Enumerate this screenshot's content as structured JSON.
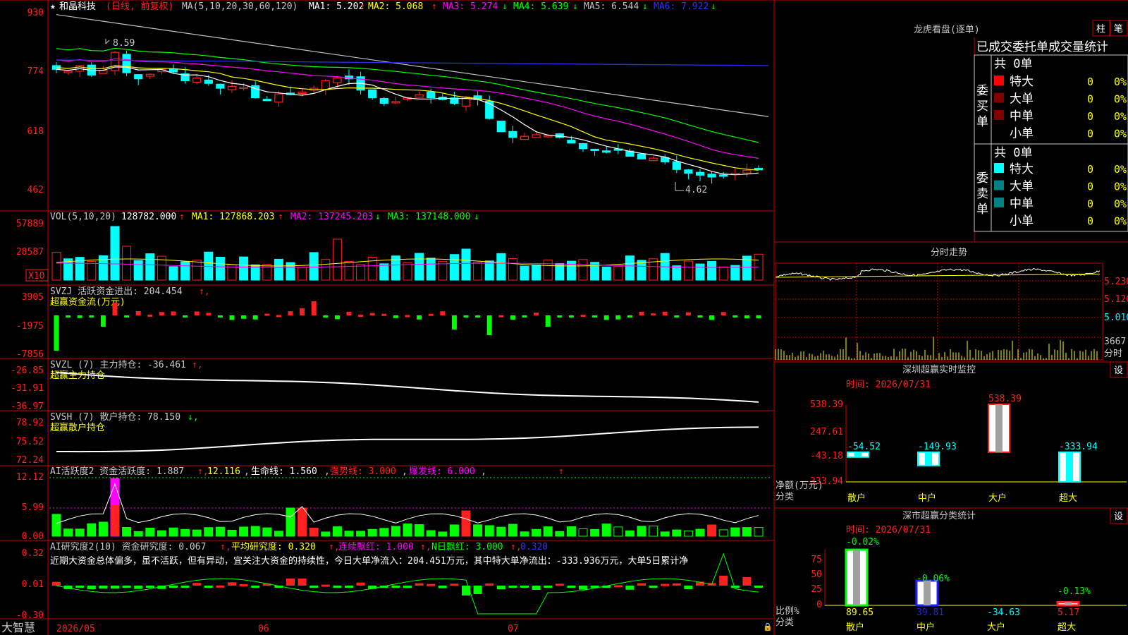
{
  "colors": {
    "up": "#ff2020",
    "down": "#00ffff",
    "ma1": "#ffffff",
    "ma2": "#ffff00",
    "ma3": "#ff00ff",
    "ma4": "#00ff00",
    "ma5": "#c0c0c0",
    "ma6": "#3030ff",
    "grid": "#c00000",
    "green": "#00ff00",
    "yellow": "#ffff00",
    "magenta": "#ff00ff",
    "blue": "#2020ff",
    "gray": "#b0b0b0",
    "teal": "#008080",
    "darkred": "#800000"
  },
  "stock_name": "和晶科技",
  "period_label": "(日线, 前复权)",
  "ma_header": {
    "formula": "MA(5,10,20,30,60,120)",
    "items": [
      {
        "label": "MA1: 5.202",
        "dir": "↑"
      },
      {
        "label": "MA2: 5.068",
        "dir": "↑"
      },
      {
        "label": "MA3: 5.274",
        "dir": "↓"
      },
      {
        "label": "MA4: 5.639",
        "dir": "↓"
      },
      {
        "label": "MA5: 6.544",
        "dir": "↓"
      },
      {
        "label": "MA6: 7.922",
        "dir": "↓"
      }
    ]
  },
  "price_axis": [
    "930",
    "774",
    "618",
    "462"
  ],
  "price_high_label": "8.59",
  "price_low_label": "4.62",
  "vol_header": {
    "formula": "VOL(5,10,20)",
    "value": "128782.000",
    "ma1": "MA1: 127868.203",
    "ma2": "MA2: 137245.203",
    "ma3": "MA3: 137148.000"
  },
  "vol_axis": [
    "57889",
    "28587"
  ],
  "vol_unit": "X10",
  "svzj": {
    "title": "SVZJ  活跃资金进出: 204.454",
    "subtitle": "超赢资金流(万元)",
    "axis": [
      "3905",
      "-1975",
      "-7856"
    ]
  },
  "svzl": {
    "title": "SVZL (7) 主力持仓: -36.461",
    "subtitle": "超赢主力持仓",
    "axis": [
      "-26.85",
      "-31.91",
      "-36.97"
    ]
  },
  "svsh": {
    "title": "SVSH (7) 散户持仓: 78.150",
    "subtitle": "超赢散户持仓",
    "axis": [
      "78.92",
      "75.52",
      "72.24"
    ]
  },
  "ai_act": {
    "title": "AI活跃度2 资金活跃度: 1.887",
    "v2": "12.116",
    "v3": "生命线: 1.560",
    "v4": "强势线: 3.000",
    "v5": "爆发线: 6.000",
    "axis": [
      "12.12",
      "5.99",
      "0.00"
    ]
  },
  "ai_res": {
    "title": "AI研究度2(10) 资金研究度: 0.067",
    "v2": "平均研究度: 0.320",
    "v3": "连续飘红: 1.000",
    "v4": "N日飘红: 3.000",
    "v5": "0.320",
    "summary": "近期大资金总体偏多，虽不活跃，但有异动，宜关注大资金的持续性，今日大单净流入：204.451万元，其中特大单净流出：-333.936万元，大单5日累计净",
    "axis": [
      "0.32",
      "0.01",
      "-0.30"
    ]
  },
  "date_axis": [
    "2026/05",
    "06",
    "07"
  ],
  "brand": "大智慧",
  "right": {
    "lhkp_title": "龙虎看盘(逐单)",
    "btn_zhu": "柱",
    "btn_bi": "笔",
    "table_title": "已成交委托单成交量统计",
    "buy_label": "委买单",
    "sell_label": "委卖单",
    "buy_total": "共 0单",
    "sell_total": "共 0单",
    "buy_rows": [
      {
        "name": "特大",
        "count": "0",
        "pct": "0%",
        "color": "#ff0000"
      },
      {
        "name": "大单",
        "count": "0",
        "pct": "0%",
        "color": "#800000"
      },
      {
        "name": "中单",
        "count": "0",
        "pct": "0%",
        "color": "#800000"
      },
      {
        "name": "小单",
        "count": "0",
        "pct": "0%",
        "color": ""
      }
    ],
    "sell_rows": [
      {
        "name": "特大",
        "count": "0",
        "pct": "0%",
        "color": "#00ffff"
      },
      {
        "name": "大单",
        "count": "0",
        "pct": "0%",
        "color": "#008080"
      },
      {
        "name": "中单",
        "count": "0",
        "pct": "0%",
        "color": "#008080"
      },
      {
        "name": "小单",
        "count": "0",
        "pct": "0%",
        "color": ""
      }
    ],
    "fs_title": "分时走势",
    "fs_axis": [
      "5.230",
      "5.120",
      "5.010"
    ],
    "fs_vol": "3667",
    "fs_vol_label": "分时",
    "sz_title": "深圳超赢实时监控",
    "btn_set": "设",
    "sz_time": "时间: 2026/07/31",
    "sz_axis": [
      "538.39",
      "247.61",
      "-43.18",
      "-333.94"
    ],
    "sz_ylabel": "净额(万元)",
    "sz_xlabel": "分类",
    "sz_bars": [
      {
        "name": "散户",
        "value": -54.52,
        "label": "-54.52"
      },
      {
        "name": "中户",
        "value": -149.93,
        "label": "-149.93"
      },
      {
        "name": "大户",
        "value": 538.39,
        "label": "538.39"
      },
      {
        "name": "超大",
        "value": -333.94,
        "label": "-333.94"
      }
    ],
    "cls_title": "深市超赢分类统计",
    "cls_time": "时间: 2026/07/31",
    "cls_axis": [
      "75",
      "50",
      "25",
      "0"
    ],
    "cls_ylabel": "比例%",
    "cls_xlabel": "分类",
    "cls_bars": [
      {
        "name": "散户",
        "value": 89.65,
        "label": "89.65",
        "chg": "-0.02%"
      },
      {
        "name": "中户",
        "value": 39.81,
        "label": "39.81",
        "chg": "-0.06%"
      },
      {
        "name": "大户",
        "value": -34.63,
        "label": "-34.63",
        "chg": ""
      },
      {
        "name": "超大",
        "value": 5.17,
        "label": "5.17",
        "chg": "-0.13%"
      }
    ]
  }
}
